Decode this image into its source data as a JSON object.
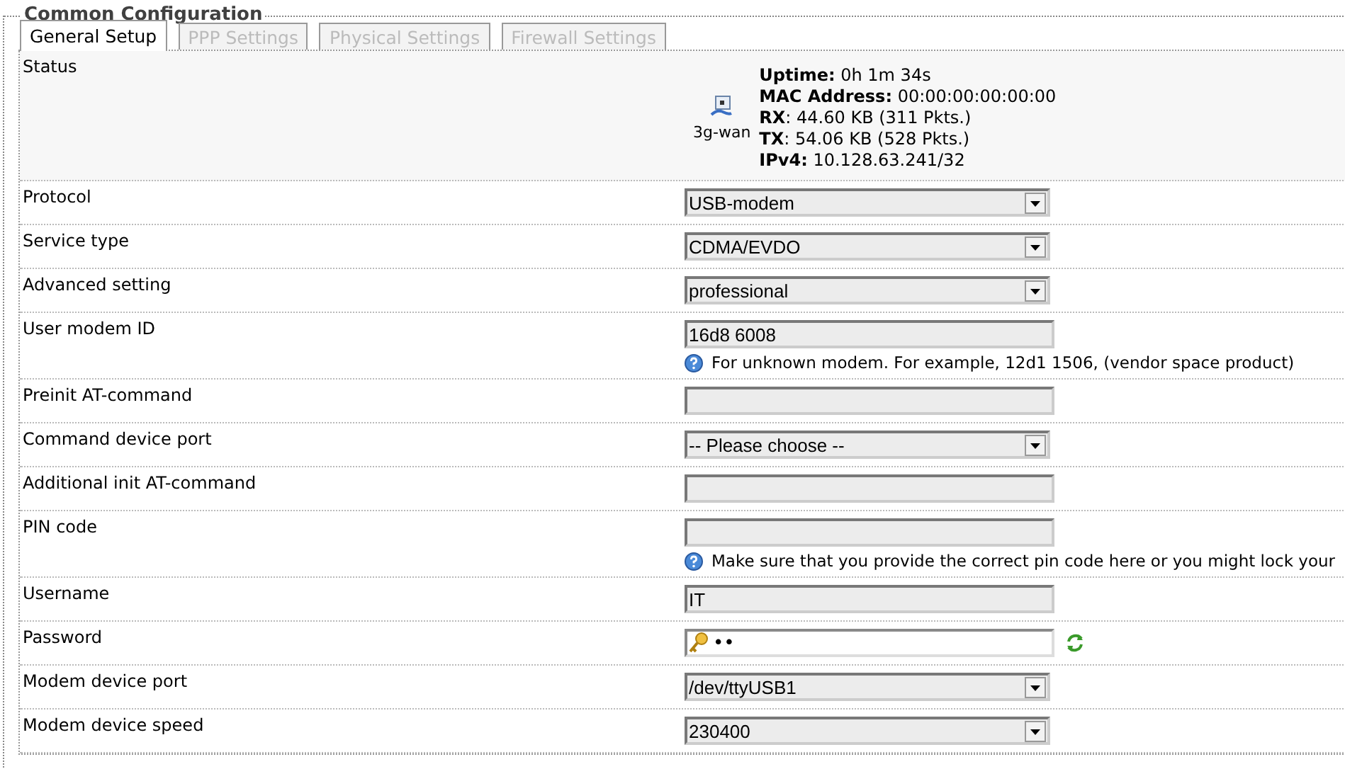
{
  "section": {
    "title": "Common Configuration"
  },
  "tabs": [
    {
      "label": "General Setup",
      "selected": true
    },
    {
      "label": "PPP Settings",
      "selected": false
    },
    {
      "label": "Physical Settings",
      "selected": false
    },
    {
      "label": "Firewall Settings",
      "selected": false
    }
  ],
  "status": {
    "label": "Status",
    "interface": "3g-wan",
    "lines": [
      "**Uptime:** 0h 1m 34s",
      "**MAC Address:** 00:00:00:00:00:00",
      "**RX**: 44.60 KB (311 Pkts.)",
      "**TX**: 54.06 KB (528 Pkts.)",
      "**IPv4:** 10.128.63.241/32"
    ]
  },
  "rows": [
    {
      "label": "Protocol",
      "kind": "select",
      "value": "USB-modem"
    },
    {
      "label": "Service type",
      "kind": "select",
      "value": "CDMA/EVDO"
    },
    {
      "label": "Advanced setting",
      "kind": "select",
      "value": "professional"
    },
    {
      "label": "User modem ID",
      "kind": "text",
      "value": "16d8 6008",
      "hint": "For unknown modem. For example, 12d1 1506, (vendor space product)"
    },
    {
      "label": "Preinit AT-command",
      "kind": "text",
      "value": ""
    },
    {
      "label": "Command device port",
      "kind": "select",
      "value": "-- Please choose --"
    },
    {
      "label": "Additional init AT-command",
      "kind": "text",
      "value": ""
    },
    {
      "label": "PIN code",
      "kind": "text",
      "value": "",
      "hint": "Make sure that you provide the correct pin code here or you might lock your"
    },
    {
      "label": "Username",
      "kind": "text",
      "value": "IT"
    },
    {
      "label": "Password",
      "kind": "password",
      "value": "••"
    },
    {
      "label": "Modem device port",
      "kind": "select",
      "value": "/dev/ttyUSB1"
    },
    {
      "label": "Modem device speed",
      "kind": "select",
      "value": "230400"
    }
  ]
}
